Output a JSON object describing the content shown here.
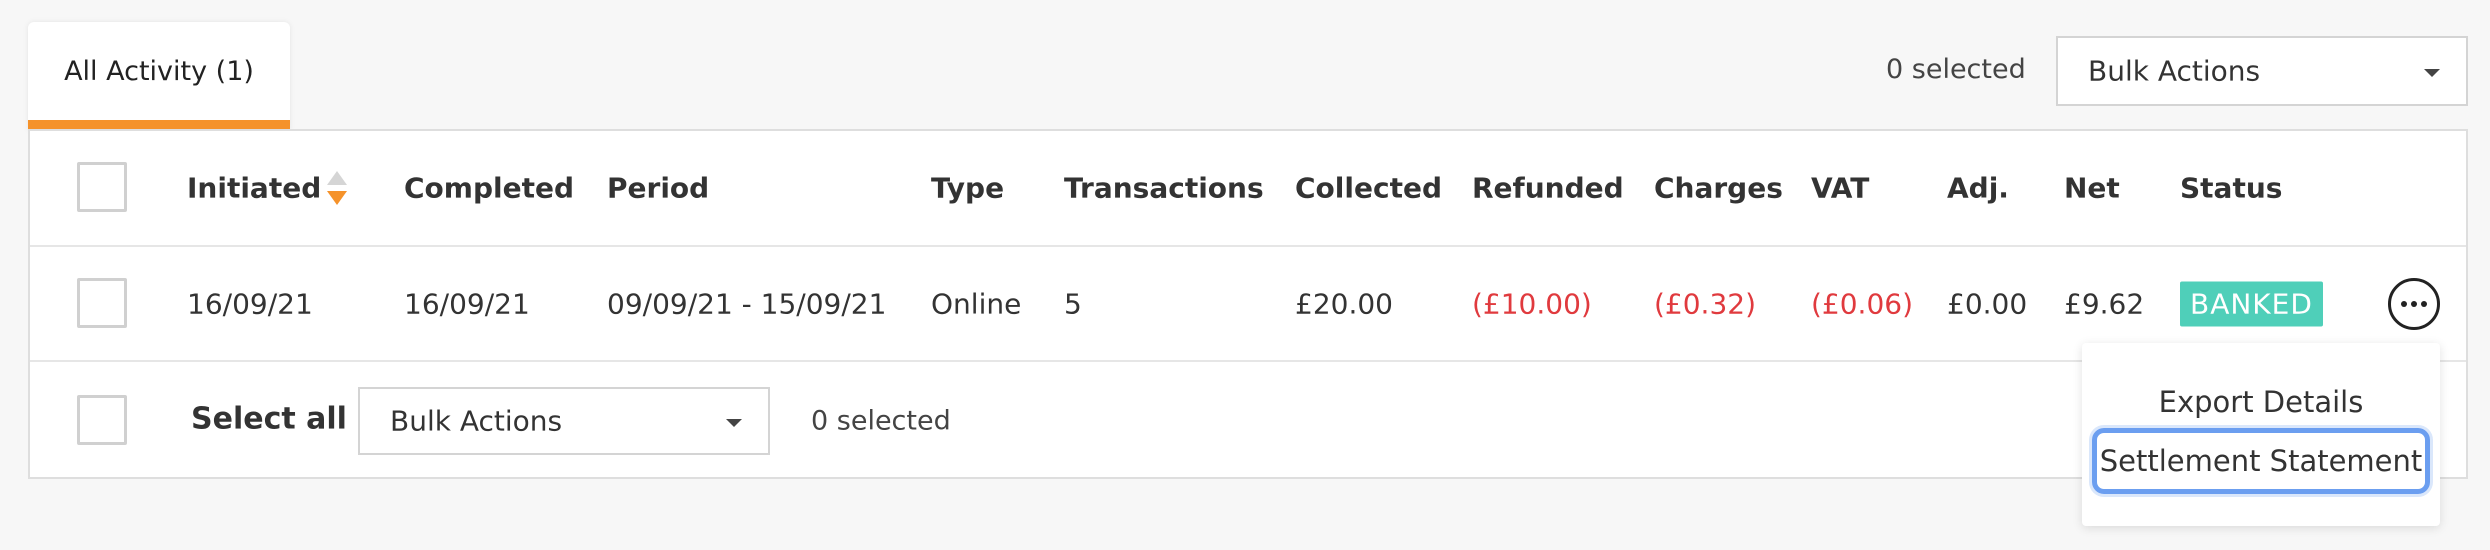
{
  "tabs": [
    {
      "label": "All Activity (1)",
      "active": true
    }
  ],
  "top_controls": {
    "selected_text": "0 selected",
    "bulk_actions_label": "Bulk Actions"
  },
  "table": {
    "columns": [
      "Initiated",
      "Completed",
      "Period",
      "Type",
      "Transactions",
      "Collected",
      "Refunded",
      "Charges",
      "VAT",
      "Adj.",
      "Net",
      "Status"
    ],
    "sort": {
      "column": "Initiated",
      "direction": "descending"
    },
    "rows": [
      {
        "initiated": "16/09/21",
        "completed": "16/09/21",
        "period": "09/09/21 - 15/09/21",
        "type": "Online",
        "transactions": "5",
        "collected": "£20.00",
        "refunded": "(£10.00)",
        "charges": "(£0.32)",
        "vat": "(£0.06)",
        "adj": "£0.00",
        "net": "£9.62",
        "status": "BANKED"
      }
    ]
  },
  "footer": {
    "select_all_label": "Select all",
    "bulk_actions_label": "Bulk Actions",
    "selected_text": "0 selected"
  },
  "row_menu": {
    "items": [
      "Export Details",
      "Settlement Statement"
    ],
    "focused_item": "Settlement Statement"
  },
  "colors": {
    "accent": "#f5922a",
    "negative": "#e03a3e",
    "status_banked": "#4fcfb9",
    "focus_ring": "#6b9ef0"
  },
  "icons": {
    "sort": "sort-desc-icon",
    "more": "more-horizontal-icon",
    "caret": "chevron-down-icon"
  }
}
